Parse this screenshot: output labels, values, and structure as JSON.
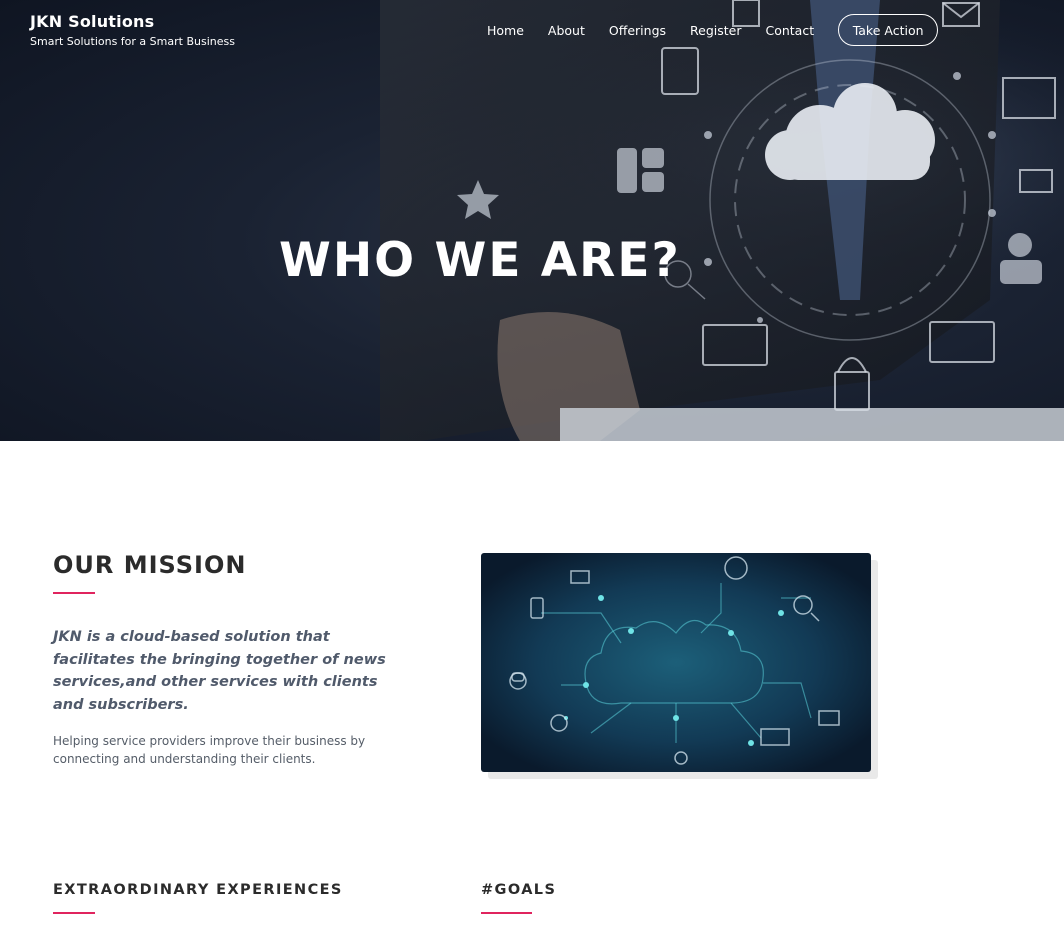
{
  "brand": {
    "name": "JKN Solutions",
    "tagline": "Smart Solutions for a Smart Business"
  },
  "nav": {
    "links": [
      "Home",
      "About",
      "Offerings",
      "Register",
      "Contact"
    ],
    "cta_label": "Take Action"
  },
  "hero": {
    "title": "WHO WE ARE?"
  },
  "mission": {
    "heading": "OUR MISSION",
    "lead": "JKN is a cloud-based solution that facilitates the bringing together of news services,and other services with clients and subscribers.",
    "body": "Helping service providers improve their business by connecting and understanding their clients."
  },
  "sections": {
    "experiences_heading": "EXTRAORDINARY EXPERIENCES",
    "goals_heading": "#GOALS"
  },
  "colors": {
    "accent": "#e0245e",
    "hero_dark": "#0f1522",
    "text_dark": "#2b2b2b"
  }
}
